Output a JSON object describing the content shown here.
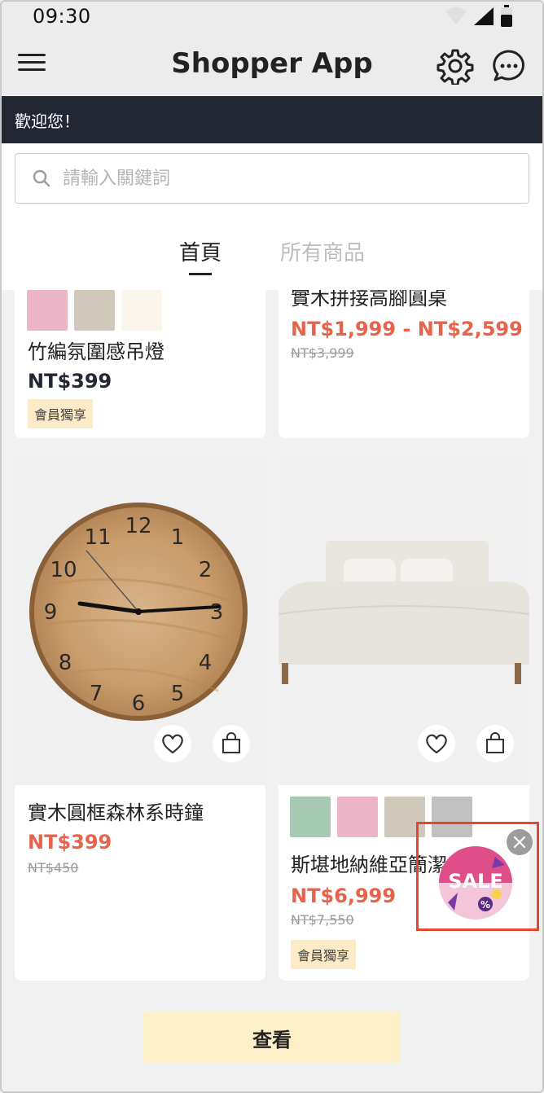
{
  "status_bar": {
    "time": "09:30"
  },
  "app_bar": {
    "title": "Shopper App"
  },
  "welcome": {
    "text": "歡迎您！"
  },
  "search": {
    "placeholder": "請輸入關鍵詞",
    "value": ""
  },
  "tabs": [
    {
      "label": "首頁",
      "active": true
    },
    {
      "label": "所有商品",
      "active": false
    }
  ],
  "products": [
    {
      "name": "竹編氛圍感吊燈",
      "price": "NT$399",
      "badge": "會員獨享",
      "swatches": [
        "#edb6c8",
        "#d0c8ba",
        "#fbf6ec"
      ]
    },
    {
      "name": "實木拼接高腳圓桌",
      "price": "NT$1,999 - NT$2,599",
      "old_price": "NT$3,999"
    },
    {
      "name": "實木圓框森林系時鐘",
      "price": "NT$399",
      "old_price": "NT$450",
      "clock_numbers": [
        "12",
        "1",
        "2",
        "3",
        "4",
        "5",
        "6",
        "7",
        "8",
        "9",
        "10",
        "11"
      ]
    },
    {
      "name": "斯堪地納維亞簡潔",
      "price": "NT$6,999",
      "old_price": "NT$7,550",
      "badge": "會員獨享",
      "swatches": [
        "#a6c9b4",
        "#edb6c8",
        "#d0c8ba",
        "#c0c0c0"
      ]
    }
  ],
  "view_button": {
    "label": "查看"
  },
  "sale_popup": {
    "label": "SALE",
    "symbol": "%"
  },
  "colors": {
    "accent_red": "#e8634b",
    "dark_navy": "#232733",
    "badge_bg": "#fdebc8",
    "button_bg": "#fdf0c8",
    "popup_border": "#e8452e"
  }
}
